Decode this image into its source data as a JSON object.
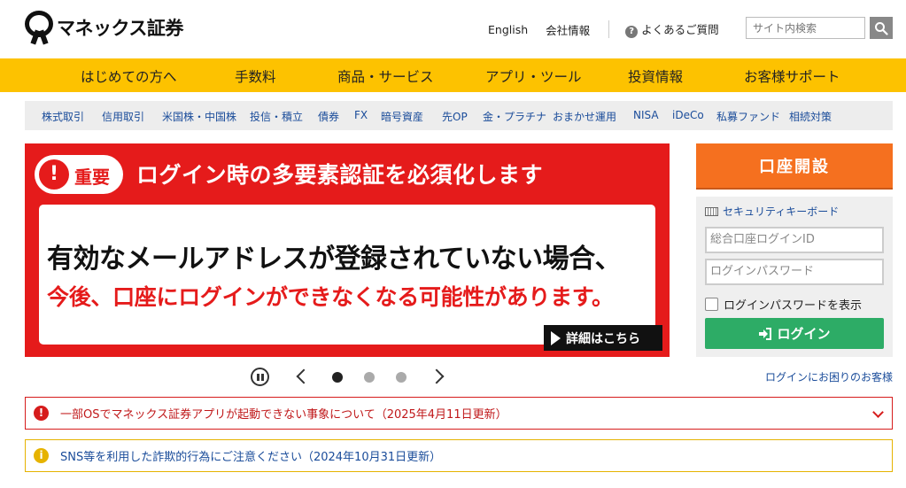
{
  "brand": {
    "logo_text": "マネックス証券"
  },
  "header": {
    "english": "English",
    "company_info": "会社情報",
    "faq": "よくあるご質問",
    "faq_icon_glyph": "?",
    "search_placeholder": "サイト内検索"
  },
  "main_nav": [
    "はじめての方へ",
    "手数料",
    "商品・サービス",
    "アプリ・ツール",
    "投資情報",
    "お客様サポート"
  ],
  "sub_nav": [
    "株式取引",
    "信用取引",
    "米国株・中国株",
    "投信・積立",
    "債券",
    "FX",
    "暗号資産",
    "先OP",
    "金・プラチナ",
    "おまかせ運用",
    "NISA",
    "iDeCo",
    "私募ファンド",
    "相続対策"
  ],
  "banner": {
    "badge_icon": "!",
    "badge": "重要",
    "title": "ログイン時の多要素認証を必須化します",
    "line1": "有効なメールアドレスが登録されていない場合、",
    "line2": "今後、口座にログインができなくなる可能性があります。",
    "detail": "詳細はこちら"
  },
  "carousel": {
    "slide_count": 3,
    "active_index": 0
  },
  "login": {
    "open_account": "口座開設",
    "security_keyboard": "セキュリティキーボード",
    "id_placeholder": "総合口座ログインID",
    "password_placeholder": "ログインパスワード",
    "show_password": "ログインパスワードを表示",
    "login_button": "ログイン",
    "help": "ログインにお困りのお客様"
  },
  "notices": [
    {
      "icon": "!",
      "text": "一部OSでマネックス証券アプリが起動できない事象について（2025年4月11日更新）",
      "level": "error",
      "color": "#d61c1c"
    },
    {
      "icon": "i",
      "text": "SNS等を利用した詐欺的行為にご注意ください（2024年10月31日更新）",
      "level": "warning",
      "color": "#e6b300"
    }
  ],
  "colors": {
    "nav_bg": "#fdc200",
    "banner_red": "#e51b1b",
    "open_account": "#f5701f",
    "login_green": "#2dac66",
    "link_blue": "#1a4c9a"
  }
}
